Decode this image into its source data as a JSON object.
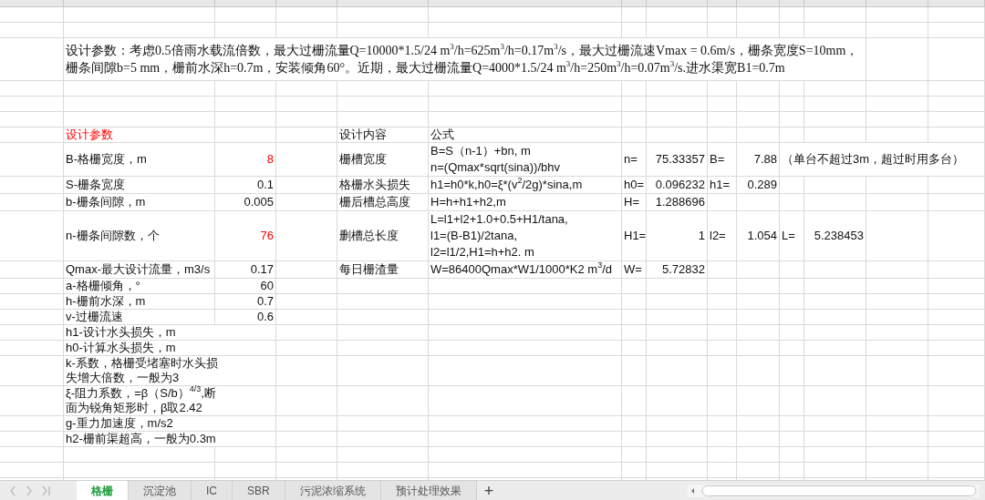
{
  "intro": "设计参数：考虑0.5倍雨水载流倍数，最大过栅流量Q=10000*1.5/24 m$^{3}$/h=625m$^{3}$/h=0.17m$^{3}$/s，最大过栅流速Vmax = 0.6m/s，栅条宽度S=10mm，栅条间隙b=5 mm，栅前水深h=0.7m，安装倾角60°。近期，最大过栅流量Q=4000*1.5/24 m$^{3}$/h=250m$^{3}$/h=0.07m$^{3}$/s.进水渠宽B1=0.7m",
  "parameters": {
    "heading": "设计参数",
    "items": [
      {
        "label": "B-格栅宽度，m",
        "value": "8",
        "highlighted": true
      },
      {
        "label": "S-栅条宽度",
        "value": "0.1",
        "highlighted": false
      },
      {
        "label": "b-栅条间隙，m",
        "value": "0.005",
        "highlighted": false
      },
      {
        "label": "n-栅条间隙数，个",
        "value": "76",
        "highlighted": true
      },
      {
        "label": "Qmax-最大设计流量，m3/s",
        "value": "0.17",
        "highlighted": false
      },
      {
        "label": "a-格栅倾角，°",
        "value": "60",
        "highlighted": false
      },
      {
        "label": "h-栅前水深，m",
        "value": "0.7",
        "highlighted": false
      },
      {
        "label": "v-过栅流速",
        "value": "0.6",
        "highlighted": false
      },
      {
        "label": "h1-设计水头损失，m"
      },
      {
        "label": "h0-计算水头损失，m"
      },
      {
        "label": "k-系数，格栅受堵塞时水头损失增大倍数，一般为3"
      },
      {
        "label": "ξ-阻力系数，=β（S/b）$^{4/3}$,断面为锐角矩形时，β取2.42"
      },
      {
        "label": "g-重力加速度，m/s2"
      },
      {
        "label": "h2-栅前渠超高，一般为0.3m"
      }
    ]
  },
  "calculations": {
    "columns": [
      "设计内容",
      "公式"
    ],
    "rows": [
      {
        "item": "栅槽宽度",
        "formula": "B=S（n-1）+bn,   m\nn=(Qmax*sqrt(sina))/bhv",
        "results": [
          {
            "label": "n=",
            "value": "75.33357"
          },
          {
            "label": "B=",
            "value": "7.88"
          }
        ],
        "note": "（单台不超过3m，超过时用多台）"
      },
      {
        "item": "格栅水头损失",
        "formula": "h1=h0*k,h0=ξ*(v$^{2}$/2g)*sina,m",
        "results": [
          {
            "label": "h0=",
            "value": "0.096232"
          },
          {
            "label": "h1=",
            "value": "0.289"
          }
        ]
      },
      {
        "item": "栅后槽总高度",
        "formula": "H=h+h1+h2,m",
        "results": [
          {
            "label": "H=",
            "value": "1.288696"
          }
        ]
      },
      {
        "item": "删槽总长度",
        "formula": "L=l1+l2+1.0+0.5+H1/tana,\nl1=(B-B1)/2tana,\nl2=l1/2,H1=h+h2.  m",
        "results": [
          {
            "label": "H1=",
            "value": "1"
          },
          {
            "label": "l2=",
            "value": "1.054"
          },
          {
            "label": "L=",
            "value": "5.238453"
          }
        ]
      },
      {
        "item": "每日栅渣量",
        "formula": "W=86400Qmax*W1/1000*K2 m$^{3}$/d",
        "results": [
          {
            "label": "W=",
            "value": "5.72832"
          }
        ]
      }
    ]
  },
  "sheet_tabs": [
    {
      "label": "格栅",
      "selected": true
    },
    {
      "label": "沉淀池",
      "selected": false
    },
    {
      "label": "IC",
      "selected": false
    },
    {
      "label": "SBR",
      "selected": false
    },
    {
      "label": "污泥浓缩系统",
      "selected": false
    },
    {
      "label": "预计处理效果",
      "selected": false
    }
  ],
  "add_tab": "+"
}
